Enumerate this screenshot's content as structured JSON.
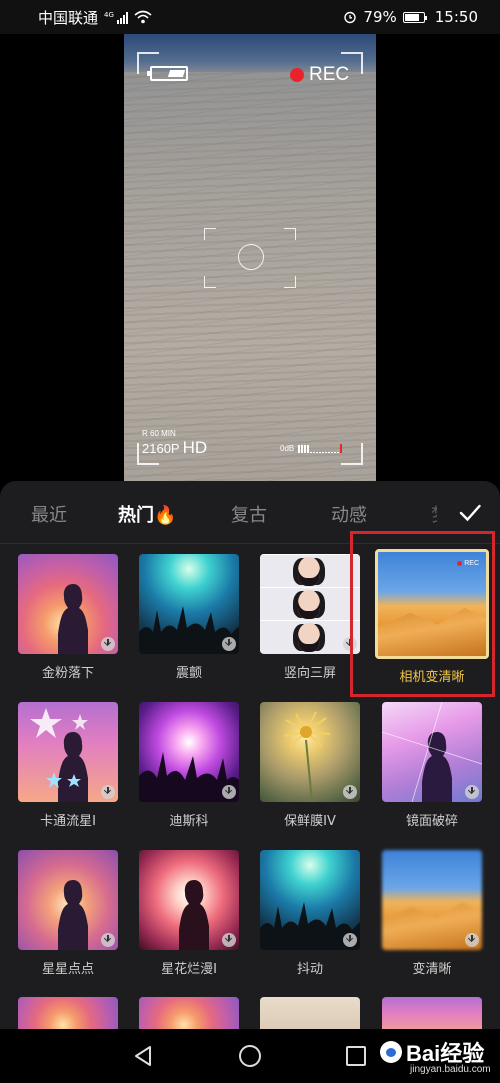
{
  "status_bar": {
    "carrier": "中国联通",
    "network": "4G",
    "battery_percent": "79%",
    "battery_level": 0.79,
    "time": "15:50"
  },
  "preview": {
    "rec_label": "REC",
    "record_info": "R 60 MIN",
    "resolution": "2160P",
    "quality": "HD",
    "audio_level_label": "0dB"
  },
  "tabs": [
    {
      "label": "最近",
      "active": false
    },
    {
      "label": "热门🔥",
      "active": true
    },
    {
      "label": "复古",
      "active": false
    },
    {
      "label": "动感",
      "active": false
    },
    {
      "label": "梦",
      "active": false
    }
  ],
  "effects": [
    {
      "label": "金粉落下",
      "thumb": "sunset-silhouette",
      "selected": false
    },
    {
      "label": "震颤",
      "thumb": "concert-crowd",
      "selected": false
    },
    {
      "label": "竖向三屏",
      "thumb": "portrait-triple",
      "selected": false
    },
    {
      "label": "相机变清晰",
      "thumb": "desert-camera",
      "selected": true
    },
    {
      "label": "卡通流星I",
      "thumb": "pink-stars-silhouette",
      "selected": false
    },
    {
      "label": "迪斯科",
      "thumb": "disco-crowd",
      "selected": false
    },
    {
      "label": "保鲜膜IV",
      "thumb": "dandelion-flower",
      "selected": false
    },
    {
      "label": "镜面破碎",
      "thumb": "mirror-silhouette",
      "selected": false
    },
    {
      "label": "星星点点",
      "thumb": "sunset-silhouette",
      "selected": false
    },
    {
      "label": "星花烂漫I",
      "thumb": "burst-silhouette",
      "selected": false
    },
    {
      "label": "抖动",
      "thumb": "concert-crowd",
      "selected": false
    },
    {
      "label": "变清晰",
      "thumb": "desert-blur",
      "selected": false
    }
  ],
  "watermark": {
    "brand": "Bai经验",
    "url": "jingyan.baidu.com"
  },
  "colors": {
    "accent": "#f3c54a",
    "selection_border": "#f1dc9a",
    "highlight": "#d6262d",
    "rec_red": "#e8232b"
  }
}
